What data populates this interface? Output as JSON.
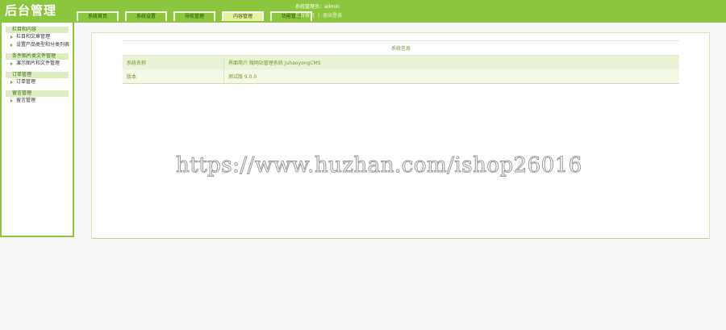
{
  "header": {
    "logo": "后台管理",
    "tabs": [
      {
        "label": "系统首页",
        "active": false
      },
      {
        "label": "系统设置",
        "active": false
      },
      {
        "label": "导航管理",
        "active": false
      },
      {
        "label": "内容管理",
        "active": true
      },
      {
        "label": "功能管理",
        "active": false
      }
    ],
    "user_info": "系统管理员：admin",
    "links": {
      "home": "后台首页",
      "sep": "|",
      "logout": "退出登录"
    }
  },
  "sidebar": {
    "groups": [
      {
        "title": "栏目和内容",
        "items": [
          "栏目和文章管理",
          "设置产品类型和分类列表"
        ]
      },
      {
        "title": "条件图片类文件管理",
        "items": [
          "演示图片和文件管理"
        ]
      },
      {
        "title": "订单管理",
        "items": [
          "订单管理"
        ]
      },
      {
        "title": "留言管理",
        "items": [
          "留言管理"
        ]
      }
    ]
  },
  "main": {
    "table_title": "系统信息",
    "rows": [
      {
        "label": "系统名称",
        "value": "界面简介 微网站管理系统 JuhaoyongCMS"
      },
      {
        "label": "版本",
        "value": "测试版 9.0.0"
      }
    ]
  },
  "watermark": "https://www.huzhan.com/ishop26016",
  "colors": {
    "accent": "#8cc63f",
    "active_tab": "#e6f0a0",
    "group_title_bg": "#dcedc0",
    "row_bg": "#eaf3d8"
  }
}
